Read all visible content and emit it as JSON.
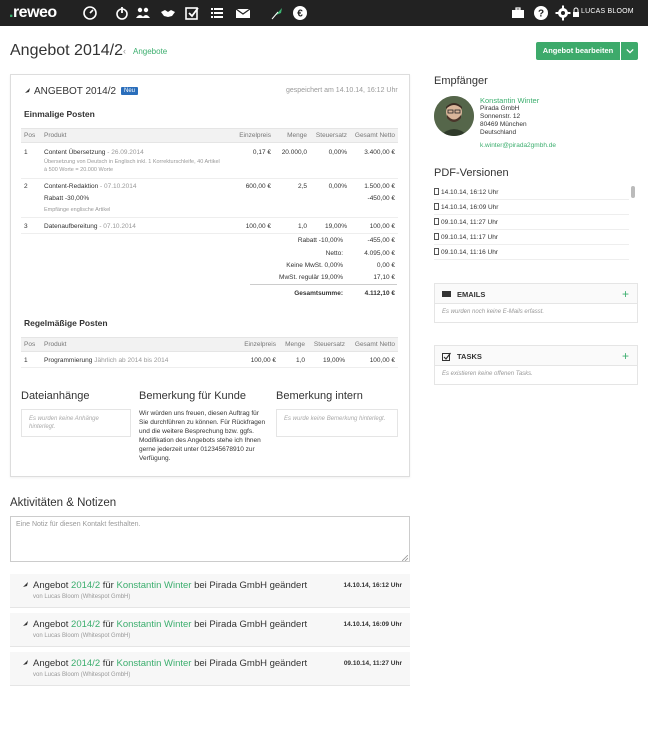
{
  "app": {
    "logo_prefix": ".",
    "logo_text": "reweo"
  },
  "user": {
    "name": "LUCAS BLOOM"
  },
  "header": {
    "title": "Angebot 2014/2",
    "breadcrumb": "Angebote",
    "edit_button": "Angebot bearbeiten"
  },
  "offer": {
    "heading": "ANGEBOT 2014/2",
    "badge": "Neu",
    "saved": "gespeichert am 14.10.14, 16:12 Uhr",
    "one_time_title": "Einmalige Posten",
    "columns": [
      "Pos",
      "Produkt",
      "Einzelpreis",
      "Menge",
      "Steuersatz",
      "Gesamt Netto"
    ],
    "items": [
      {
        "pos": "1",
        "product": "Content Übersetzung",
        "date": "- 26.09.2014",
        "desc": "Übersetzung von Deutsch in Englisch inkl. 1 Korrekturschleife, 40 Artikel à 500 Worte = 20.000 Worte",
        "price": "0,17 €",
        "qty": "20.000,0",
        "tax": "0,00%",
        "total": "3.400,00 €"
      },
      {
        "pos": "2",
        "product": "Content-Redaktion",
        "date": "- 07.10.2014",
        "discount": "Rabatt -30,00%",
        "discount_total": "-450,00 €",
        "desc": "Empfänge englische Artikel",
        "price": "600,00 €",
        "qty": "2,5",
        "tax": "0,00%",
        "total": "1.500,00 €"
      },
      {
        "pos": "3",
        "product": "Datenaufbereitung",
        "date": "- 07.10.2014",
        "price": "100,00 €",
        "qty": "1,0",
        "tax": "19,00%",
        "total": "100,00 €"
      }
    ],
    "summary": [
      {
        "label": "Rabatt -10,00%",
        "value": "-455,00 €"
      },
      {
        "label": "Netto:",
        "value": "4.095,00 €"
      },
      {
        "label": "Keine MwSt. 0,00%",
        "value": "0,00 €"
      },
      {
        "label": "MwSt. regulär 19,00%",
        "value": "17,10 €"
      }
    ],
    "total_label": "Gesamtsumme:",
    "total_value": "4.112,10 €",
    "recurring_title": "Regelmäßige Posten",
    "recurring": [
      {
        "pos": "1",
        "product": "Programmierung",
        "schedule": "Jährlich ab 2014 bis 2014",
        "price": "100,00 €",
        "qty": "1,0",
        "tax": "19,00%",
        "total": "100,00 €"
      }
    ],
    "attachments_title": "Dateianhänge",
    "attachments_empty": "Es wurden keine Anhänge hinterlegt.",
    "customer_note_title": "Bemerkung für Kunde",
    "customer_note": "Wir würden uns freuen, diesen Auftrag für Sie durchführen zu können. Für Rückfragen und die weitere Besprechung bzw. ggfs. Modifikation des Angebots stehe ich Ihnen gerne jederzeit unter 012345678910 zur Verfügung.",
    "internal_note_title": "Bemerkung intern",
    "internal_note_empty": "Es wurde keine Bemerkung hinterlegt."
  },
  "activities": {
    "title": "Aktivitäten & Notizen",
    "note_placeholder": "Eine Notiz für diesen Kontakt festhalten.",
    "items": [
      {
        "prefix": "Angebot",
        "offer": "2014/2",
        "mid": "für",
        "contact": "Konstantin Winter",
        "rest": "bei Pirada GmbH geändert",
        "by": "von Lucas Bloom (Whitespot GmbH)",
        "time": "14.10.14, 16:12 Uhr"
      },
      {
        "prefix": "Angebot",
        "offer": "2014/2",
        "mid": "für",
        "contact": "Konstantin Winter",
        "rest": "bei Pirada GmbH geändert",
        "by": "von Lucas Bloom (Whitespot GmbH)",
        "time": "14.10.14, 16:09 Uhr"
      },
      {
        "prefix": "Angebot",
        "offer": "2014/2",
        "mid": "für",
        "contact": "Konstantin Winter",
        "rest": "bei Pirada GmbH geändert",
        "by": "von Lucas Bloom (Whitespot GmbH)",
        "time": "09.10.14, 11:27 Uhr"
      }
    ]
  },
  "recipient": {
    "title": "Empfänger",
    "name": "Konstantin Winter",
    "company": "Pirada GmbH",
    "street": "Sonnenstr. 12",
    "city": "80469 München",
    "country": "Deutschland",
    "email": "k.winter@pirada2gmbh.de"
  },
  "pdf": {
    "title": "PDF-Versionen",
    "items": [
      "14.10.14, 16:12 Uhr",
      "14.10.14, 16:09 Uhr",
      "09.10.14, 11:27 Uhr",
      "09.10.14, 11:17 Uhr",
      "09.10.14, 11:16 Uhr"
    ]
  },
  "emails": {
    "title": "EMAILS",
    "empty": "Es wurden noch keine E-Mails erfasst."
  },
  "tasks": {
    "title": "TASKS",
    "empty": "Es existieren keine offenen Tasks."
  },
  "colors": {
    "accent": "#3daa6b",
    "topbar": "#222222",
    "badge": "#2a6ebb"
  }
}
